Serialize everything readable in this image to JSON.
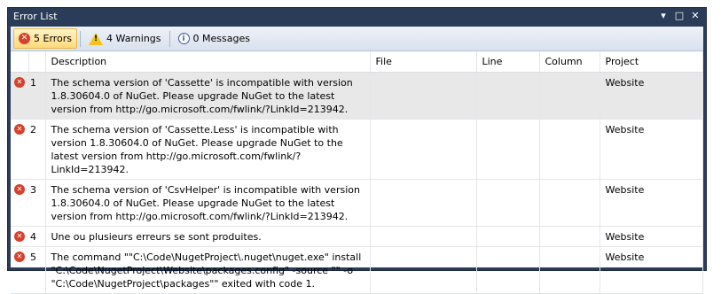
{
  "window": {
    "title": "Error List",
    "buttons": {
      "dropdown": "▾",
      "maximize": "□",
      "close": "✕"
    }
  },
  "toolbar": {
    "errors_label": "5 Errors",
    "warnings_label": "4 Warnings",
    "messages_label": "0 Messages"
  },
  "columns": {
    "description": "Description",
    "file": "File",
    "line": "Line",
    "column": "Column",
    "project": "Project"
  },
  "rows": [
    {
      "num": "1",
      "description": "The schema version of 'Cassette' is incompatible with version 1.8.30604.0 of NuGet. Please upgrade NuGet to the latest version from http://go.microsoft.com/fwlink/?LinkId=213942.",
      "file": "",
      "line": "",
      "column": "",
      "project": "Website"
    },
    {
      "num": "2",
      "description": "The schema version of 'Cassette.Less' is incompatible with version 1.8.30604.0 of NuGet. Please upgrade NuGet to the latest version from http://go.microsoft.com/fwlink/?LinkId=213942.",
      "file": "",
      "line": "",
      "column": "",
      "project": "Website"
    },
    {
      "num": "3",
      "description": "The schema version of 'CsvHelper' is incompatible with version 1.8.30604.0 of NuGet. Please upgrade NuGet to the latest version from http://go.microsoft.com/fwlink/?LinkId=213942.",
      "file": "",
      "line": "",
      "column": "",
      "project": "Website"
    },
    {
      "num": "4",
      "description": "Une ou plusieurs erreurs se sont produites.",
      "file": "",
      "line": "",
      "column": "",
      "project": "Website"
    },
    {
      "num": "5",
      "description": "The command \"\"C:\\Code\\NugetProject\\.nuget\\nuget.exe\" install \"C:\\Code\\NugetProject\\Website\\packages.config\" -source \"\" -o \"C:\\Code\\NugetProject\\packages\"\" exited with code 1.",
      "file": "",
      "line": "",
      "column": "",
      "project": "Website"
    }
  ],
  "colors": {
    "frame": "#2b3c59",
    "error_icon": "#d6412b",
    "warning_icon": "#f3c51a",
    "selected_row": "#e8e8e8"
  }
}
